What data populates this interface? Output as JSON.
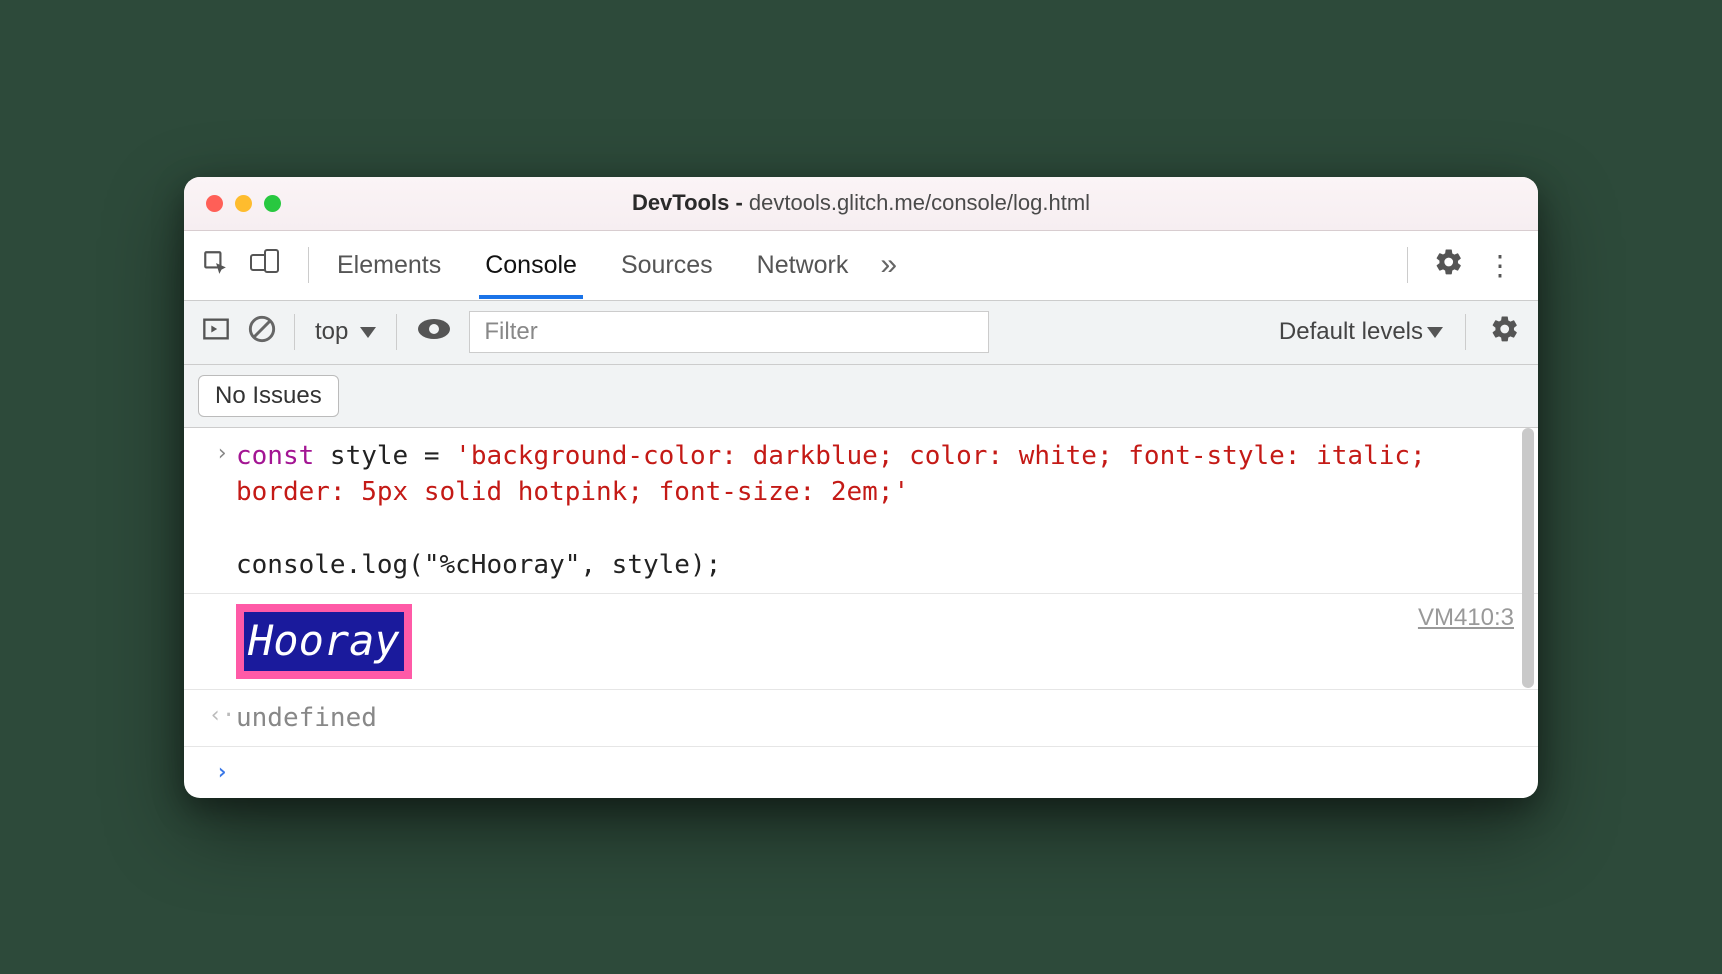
{
  "window": {
    "title_prefix": "DevTools - ",
    "title_url": "devtools.glitch.me/console/log.html"
  },
  "tabs": {
    "elements": "Elements",
    "console": "Console",
    "sources": "Sources",
    "network": "Network"
  },
  "toolbar": {
    "context": "top",
    "filter_placeholder": "Filter",
    "levels": "Default levels"
  },
  "issues": {
    "label": "No Issues"
  },
  "code": {
    "kw": "const",
    "decl": " style = ",
    "str": "'background-color: darkblue; color: white; font-style: italic; border: 5px solid hotpink; font-size: 2em;'",
    "call": "console.log(\"%cHooray\", style);"
  },
  "output": {
    "styled": "Hooray",
    "source": "VM410:3",
    "return": "undefined"
  },
  "prompts": {
    "in": "›",
    "out": "‹",
    "cmd": "›"
  }
}
